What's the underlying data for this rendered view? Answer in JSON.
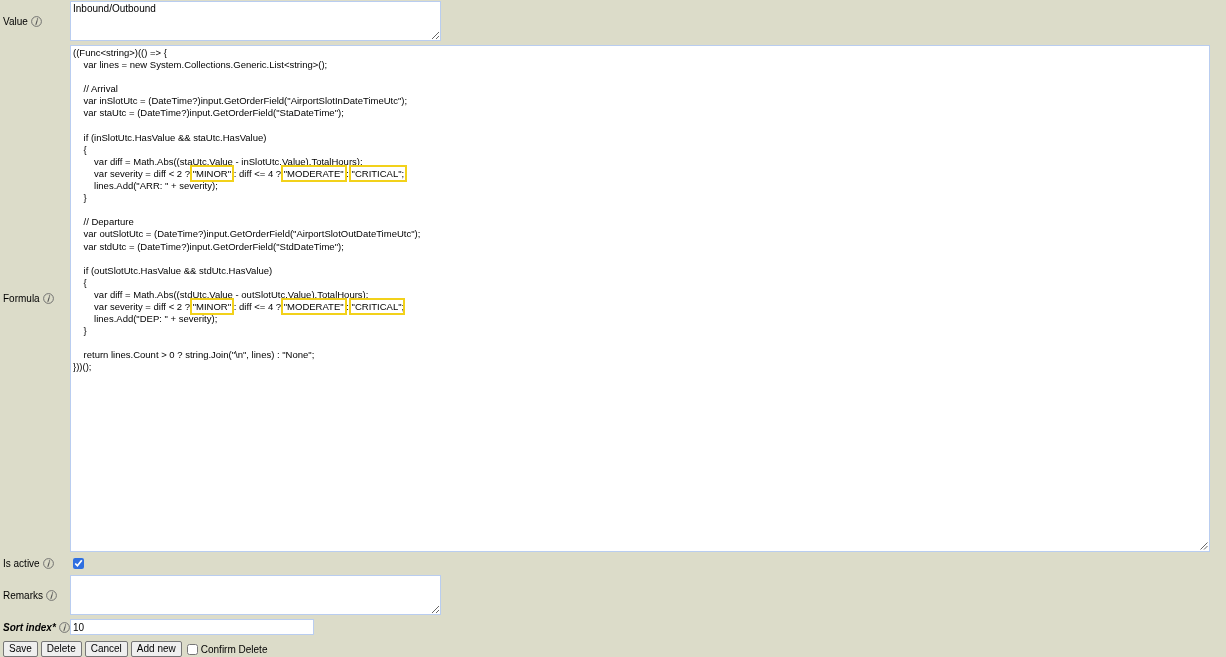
{
  "fields": [
    {
      "kind": "textarea",
      "label": "Value",
      "required": false,
      "value": "Inbound/Outbound"
    },
    {
      "kind": "code",
      "label": "Formula",
      "required": false,
      "segments": [
        {
          "text": "((Func<string>)(() => {\n    var lines = new System.Collections.Generic.List<string>();\n\n    // Arrival\n    var inSlotUtc = (DateTime?)input.GetOrderField(\"AirportSlotInDateTimeUtc\");\n    var staUtc = (DateTime?)input.GetOrderField(\"StaDateTime\");\n\n    if (inSlotUtc.HasValue && staUtc.HasValue)\n    {\n        var diff = Math.Abs((staUtc.Value - inSlotUtc.Value).TotalHours);\n        var severity = diff < 2 ? ",
          "highlighted": false
        },
        {
          "text": "\"MINOR\"",
          "highlighted": true
        },
        {
          "text": " : diff <= 4 ? ",
          "highlighted": false
        },
        {
          "text": "\"MODERATE\"",
          "highlighted": true
        },
        {
          "text": " : ",
          "highlighted": false
        },
        {
          "text": "\"CRITICAL\";",
          "highlighted": true
        },
        {
          "text": "\n        lines.Add(\"ARR: \" + severity);\n    }\n\n    // Departure\n    var outSlotUtc = (DateTime?)input.GetOrderField(\"AirportSlotOutDateTimeUtc\");\n    var stdUtc = (DateTime?)input.GetOrderField(\"StdDateTime\");\n\n    if (outSlotUtc.HasValue && stdUtc.HasValue)\n    {\n        var diff = Math.Abs((stdUtc.Value - outSlotUtc.Value).TotalHours);\n        var severity = diff < 2 ? ",
          "highlighted": false
        },
        {
          "text": "\"MINOR\"",
          "highlighted": true
        },
        {
          "text": " : diff <= 4 ? ",
          "highlighted": false
        },
        {
          "text": "\"MODERATE\"",
          "highlighted": true
        },
        {
          "text": " : ",
          "highlighted": false
        },
        {
          "text": "\"CRITICAL\"",
          "highlighted": true
        },
        {
          "text": ";\n        lines.Add(\"DEP: \" + severity);\n    }\n\n    return lines.Count > 0 ? string.Join(\"\\n\", lines) : \"None\";\n}))();",
          "highlighted": false
        }
      ]
    },
    {
      "kind": "checkbox",
      "label": "Is active",
      "required": false,
      "checked": true
    },
    {
      "kind": "textarea",
      "label": "Remarks",
      "required": false
    },
    {
      "kind": "text",
      "label": "Sort index*",
      "required": true,
      "value": "10"
    }
  ],
  "buttons": [
    "Save",
    "Delete",
    "Cancel",
    "Add new"
  ],
  "confirm_delete": {
    "label": "Confirm Delete",
    "checked": false
  }
}
